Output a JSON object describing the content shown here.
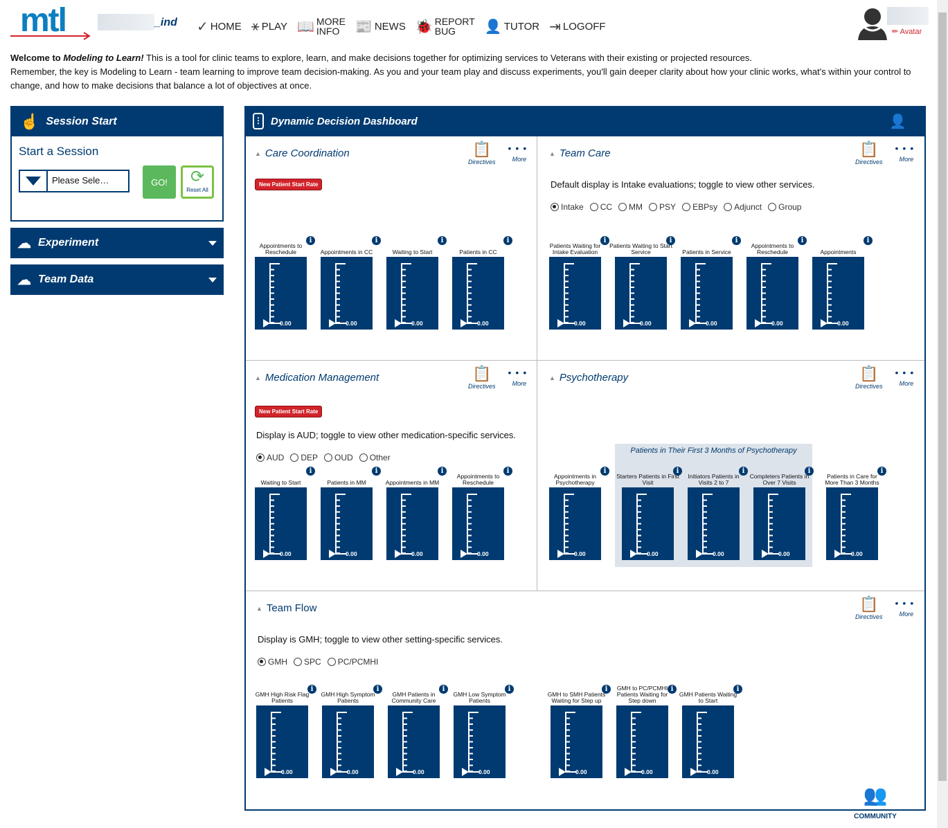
{
  "header": {
    "logo": "mtl",
    "user_suffix": "_ind",
    "avatar_label": "Avatar",
    "nav": [
      {
        "icon": "check-icon",
        "label": "HOME"
      },
      {
        "icon": "play-figure-icon",
        "label": "PLAY"
      },
      {
        "icon": "book-icon",
        "label": "MORE INFO"
      },
      {
        "icon": "news-icon",
        "label": "NEWS"
      },
      {
        "icon": "bug-icon",
        "label": "REPORT BUG"
      },
      {
        "icon": "tutor-icon",
        "label": "TUTOR"
      },
      {
        "icon": "logoff-icon",
        "label": "LOGOFF"
      }
    ]
  },
  "intro": {
    "welcome": "Welcome to ",
    "app_name": "Modeling to Learn!",
    "line1": " This is a tool for clinic teams to explore, learn, and make decisions together for optimizing services to Veterans with their existing or projected resources.",
    "line2": "Remember, the key is Modeling to Learn - team learning to improve team decision-making. As you and your team play and discuss experiments, you'll gain deeper clarity about how your clinic works, what's within your control to change, and how to make decisions that balance a lot of objectives at once."
  },
  "sidebar": {
    "session_title": "Session Start",
    "start_heading": "Start a Session",
    "select_value": "Please Sele…",
    "go": "GO!",
    "reset": "Reset All",
    "experiment": "Experiment",
    "team_data": "Team Data"
  },
  "dashboard": {
    "title": "Dynamic Decision Dashboard",
    "directives": "Directives",
    "more": "More",
    "community": "COMMUNITY",
    "care_coordination": {
      "title": "Care Coordination",
      "badge": "New Patient Start Rate",
      "gauges": [
        {
          "label": "Appointments to Reschedule",
          "value": "0.00"
        },
        {
          "label": "Appointments in CC",
          "value": "0.00"
        },
        {
          "label": "Waiting to Start",
          "value": "0.00"
        },
        {
          "label": "Patients in CC",
          "value": "0.00"
        }
      ]
    },
    "team_care": {
      "title": "Team Care",
      "note": "Default display is Intake evaluations; toggle to view other services.",
      "options": [
        "Intake",
        "CC",
        "MM",
        "PSY",
        "EBPsy",
        "Adjunct",
        "Group"
      ],
      "selected": "Intake",
      "gauges": [
        {
          "label": "Patients Waiting for Intake Evaluation",
          "value": "0.00"
        },
        {
          "label": "Patients Waiting to Start Service",
          "value": "0.00"
        },
        {
          "label": "Patients in Service",
          "value": "0.00"
        },
        {
          "label": "Appointments to Reschedule",
          "value": "0.00"
        },
        {
          "label": "Appointments",
          "value": "0.00"
        }
      ]
    },
    "medication_management": {
      "title": "Medication Management",
      "badge": "New Patient Start Rate",
      "note": "Display is AUD; toggle to view other medication-specific services.",
      "options": [
        "AUD",
        "DEP",
        "OUD",
        "Other"
      ],
      "selected": "AUD",
      "gauges": [
        {
          "label": "Waiting to Start",
          "value": "0.00"
        },
        {
          "label": "Patients in MM",
          "value": "0.00"
        },
        {
          "label": "Appointments in MM",
          "value": "0.00"
        },
        {
          "label": "Appointments to Reschedule",
          "value": "0.00"
        }
      ]
    },
    "psychotherapy": {
      "title": "Psychotherapy",
      "group_title": "Patients in Their First 3 Months of Psychotherapy",
      "gauges": [
        {
          "label": "Appointments in Psychotherapy",
          "value": "0.00"
        },
        {
          "label": "Starters Patients in First Visit",
          "value": "0.00"
        },
        {
          "label": "Initiators Patients in Visits 2 to 7",
          "value": "0.00"
        },
        {
          "label": "Completers Patients in Over 7 Visits",
          "value": "0.00"
        },
        {
          "label": "Patients in Care for More Than 3 Months",
          "value": "0.00"
        }
      ]
    },
    "team_flow": {
      "title": "Team Flow",
      "note": "Display is GMH; toggle to view other setting-specific services.",
      "options": [
        "GMH",
        "SPC",
        "PC/PCMHI"
      ],
      "selected": "GMH",
      "gauges": [
        {
          "label": "GMH High Risk Flag Patients",
          "value": "0.00"
        },
        {
          "label": "GMH High Symptom Patients",
          "value": "0.00"
        },
        {
          "label": "GMH Patients in Community Care",
          "value": "0.00"
        },
        {
          "label": "GMH Low Symptom Patients",
          "value": "0.00"
        },
        {
          "label": "GMH to SMH Patients Waiting for Step up",
          "value": "0.00"
        },
        {
          "label": "GMH to PC/PCMHI Patients Waiting for Step down",
          "value": "0.00"
        },
        {
          "label": "GMH Patients Waiting to Start",
          "value": "0.00"
        }
      ]
    }
  },
  "colors": {
    "navy": "#003a70",
    "go_green": "#5cb85c",
    "badge_red": "#d2232a",
    "logo_blue": "#0b7fc0"
  }
}
